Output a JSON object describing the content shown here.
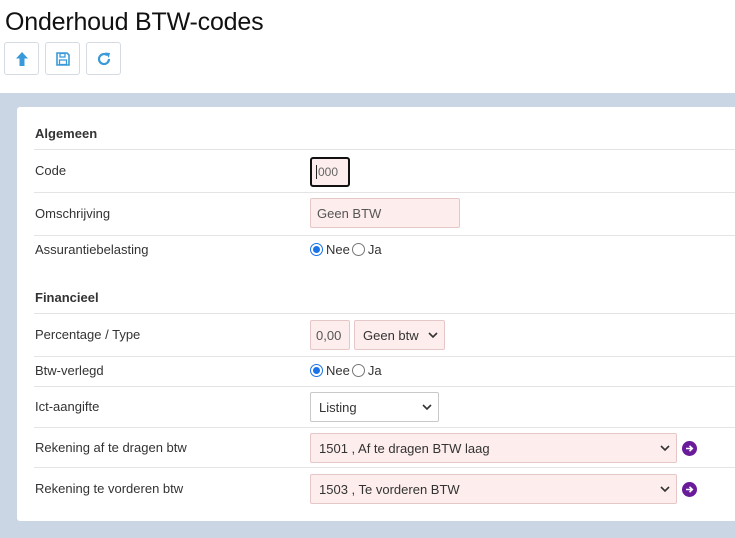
{
  "header": {
    "title": "Onderhoud BTW-codes"
  },
  "toolbar": {
    "buttons": [
      "up-arrow-icon",
      "save-icon",
      "refresh-icon"
    ]
  },
  "colors": {
    "accent": "#3a9ad9",
    "required_bg": "#fdeded",
    "band": "#cbd6e4",
    "go_icon": "#6a1b9a"
  },
  "form": {
    "general": {
      "title": "Algemeen",
      "code": {
        "label": "Code",
        "value": "000"
      },
      "omschrijving": {
        "label": "Omschrijving",
        "value": "Geen BTW"
      },
      "assurantie": {
        "label": "Assurantiebelasting",
        "option_no": "Nee",
        "option_yes": "Ja",
        "selected": "Nee"
      }
    },
    "financial": {
      "title": "Financieel",
      "percentage": {
        "label": "Percentage / Type",
        "value": "0,00",
        "type_selected": "Geen btw"
      },
      "verlegd": {
        "label": "Btw-verlegd",
        "option_no": "Nee",
        "option_yes": "Ja",
        "selected": "Nee"
      },
      "ict": {
        "label": "Ict-aangifte",
        "selected": "Listing"
      },
      "afdragen": {
        "label": "Rekening af te dragen btw",
        "selected": "1501 , Af te dragen BTW laag"
      },
      "vorderen": {
        "label": "Rekening te vorderen btw",
        "selected": "1503 , Te vorderen BTW"
      }
    }
  }
}
